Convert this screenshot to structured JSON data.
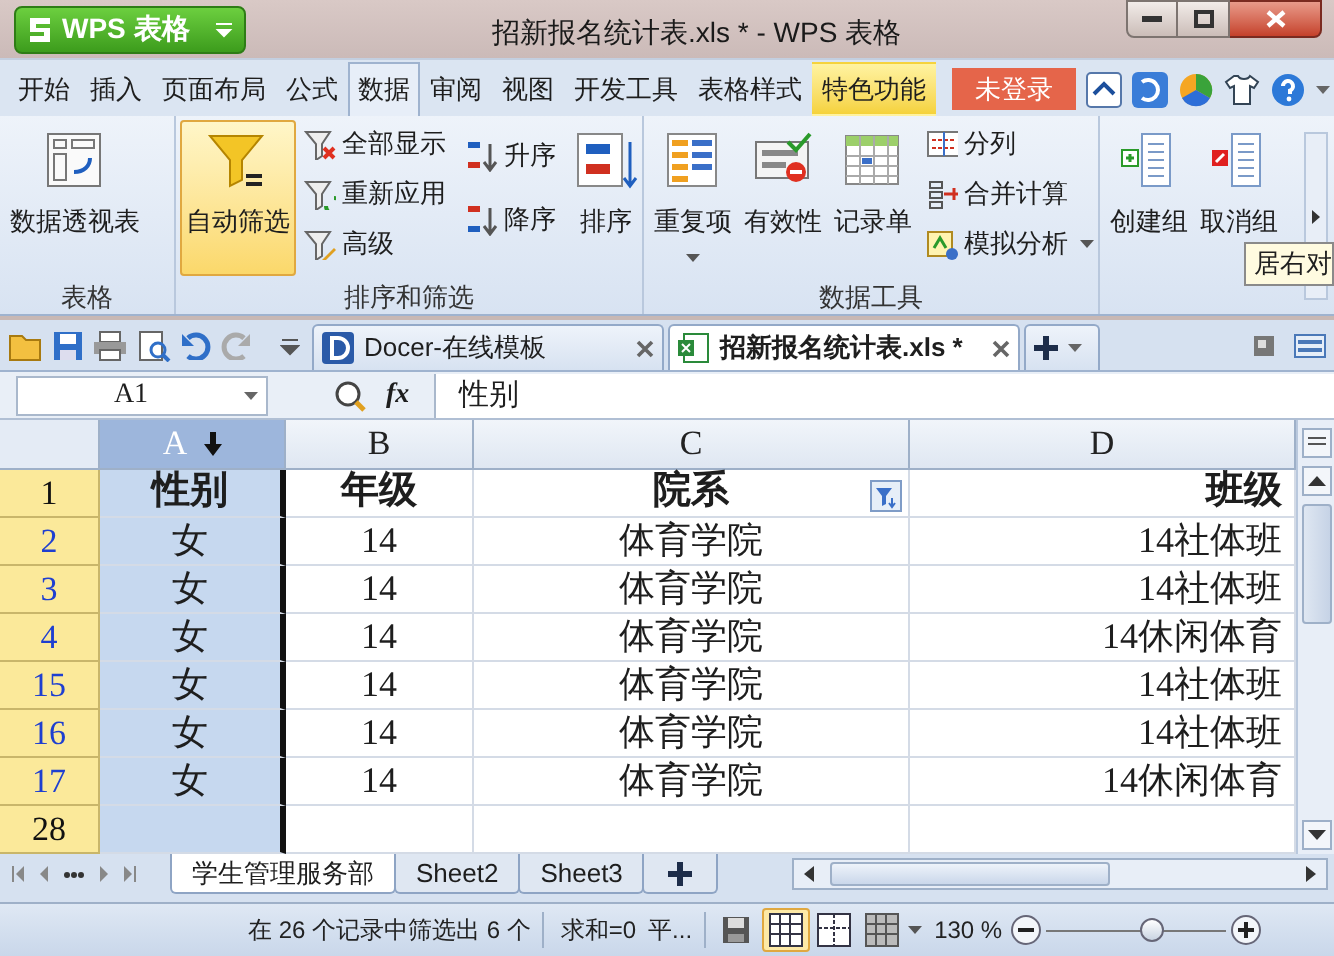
{
  "app_button": {
    "label": "WPS 表格"
  },
  "window": {
    "title": "招新报名统计表.xls * - WPS 表格"
  },
  "menu_tabs": [
    {
      "label": "开始",
      "selected": false,
      "kind": "tab"
    },
    {
      "label": "插入",
      "selected": false,
      "kind": "tab"
    },
    {
      "label": "页面布局",
      "selected": false,
      "kind": "tab"
    },
    {
      "label": "公式",
      "selected": false,
      "kind": "tab"
    },
    {
      "label": "数据",
      "selected": true,
      "kind": "tab"
    },
    {
      "label": "审阅",
      "selected": false,
      "kind": "tab"
    },
    {
      "label": "视图",
      "selected": false,
      "kind": "tab"
    },
    {
      "label": "开发工具",
      "selected": false,
      "kind": "tab"
    },
    {
      "label": "表格样式",
      "selected": false,
      "kind": "tab"
    },
    {
      "label": "特色功能",
      "selected": false,
      "kind": "feature"
    }
  ],
  "login_button": {
    "label": "未登录"
  },
  "ribbon_groups": [
    {
      "label": "表格",
      "items": [
        {
          "label": "数据透视表",
          "kind": "large",
          "on": false,
          "dropdown": false
        }
      ]
    },
    {
      "label": "排序和筛选",
      "items": [
        {
          "label": "自动筛选",
          "kind": "large",
          "on": true,
          "dropdown": false
        },
        {
          "label": "全部显示",
          "kind": "small",
          "on": false,
          "dropdown": false
        },
        {
          "label": "重新应用",
          "kind": "small",
          "on": false,
          "dropdown": false
        },
        {
          "label": "高级",
          "kind": "small",
          "on": false,
          "dropdown": false
        },
        {
          "label": "升序",
          "kind": "small",
          "on": false,
          "dropdown": false
        },
        {
          "label": "降序",
          "kind": "small",
          "on": false,
          "dropdown": false
        },
        {
          "label": "排序",
          "kind": "large",
          "on": false,
          "dropdown": false
        }
      ]
    },
    {
      "label": "数据工具",
      "items": [
        {
          "label": "重复项",
          "kind": "large",
          "on": false,
          "dropdown": true
        },
        {
          "label": "有效性",
          "kind": "large",
          "on": false,
          "dropdown": false
        },
        {
          "label": "记录单",
          "kind": "large",
          "on": false,
          "dropdown": false
        },
        {
          "label": "分列",
          "kind": "small",
          "on": false,
          "dropdown": false
        },
        {
          "label": "合并计算",
          "kind": "small",
          "on": false,
          "dropdown": false
        },
        {
          "label": "模拟分析",
          "kind": "small",
          "on": false,
          "dropdown": true
        }
      ]
    },
    {
      "items": [
        {
          "label": "创建组",
          "kind": "large",
          "on": false,
          "dropdown": false
        },
        {
          "label": "取消组",
          "kind": "large",
          "on": false,
          "dropdown": false
        }
      ]
    }
  ],
  "tooltip": {
    "text": "居右对"
  },
  "doc_tabs": [
    {
      "label": "Docer-在线模板",
      "selected": false
    },
    {
      "label": "招新报名统计表.xls *",
      "selected": true
    }
  ],
  "formula_bar": {
    "name_box": "A1",
    "fx": "fx",
    "value": "性别"
  },
  "columns": [
    {
      "label": "A",
      "selected": true,
      "filter_applied": false
    },
    {
      "label": "B",
      "selected": false,
      "filter_applied": false
    },
    {
      "label": "C",
      "selected": false,
      "filter_applied": true
    },
    {
      "label": "D",
      "selected": false,
      "filter_applied": false
    }
  ],
  "rows": [
    {
      "number": "1",
      "filtered": false,
      "kind": "header",
      "cells": [
        "性别",
        "年级",
        "院系",
        "班级"
      ]
    },
    {
      "number": "2",
      "filtered": true,
      "kind": "data",
      "cells": [
        "女",
        "14",
        "体育学院",
        "14社体班"
      ]
    },
    {
      "number": "3",
      "filtered": true,
      "kind": "data",
      "cells": [
        "女",
        "14",
        "体育学院",
        "14社体班"
      ]
    },
    {
      "number": "4",
      "filtered": true,
      "kind": "data",
      "cells": [
        "女",
        "14",
        "体育学院",
        "14休闲体育"
      ]
    },
    {
      "number": "15",
      "filtered": true,
      "kind": "data",
      "cells": [
        "女",
        "14",
        "体育学院",
        "14社体班"
      ]
    },
    {
      "number": "16",
      "filtered": true,
      "kind": "data",
      "cells": [
        "女",
        "14",
        "体育学院",
        "14社体班"
      ]
    },
    {
      "number": "17",
      "filtered": true,
      "kind": "data",
      "cells": [
        "女",
        "14",
        "体育学院",
        "14休闲体育"
      ]
    },
    {
      "number": "28",
      "filtered": false,
      "kind": "data",
      "cells": [
        "",
        "",
        "",
        ""
      ]
    }
  ],
  "sheet_tabs": [
    {
      "label": "学生管理服务部",
      "selected": true
    },
    {
      "label": "Sheet2",
      "selected": false
    },
    {
      "label": "Sheet3",
      "selected": false
    }
  ],
  "status_bar": {
    "message": "在 26 个记录中筛选出 6 个",
    "sum": "求和=0",
    "more": "平...",
    "zoom": "130 %",
    "views": [
      {
        "selected": true
      },
      {
        "selected": false
      },
      {
        "selected": false
      }
    ],
    "zoom_slider": {
      "level": 0.6
    }
  }
}
